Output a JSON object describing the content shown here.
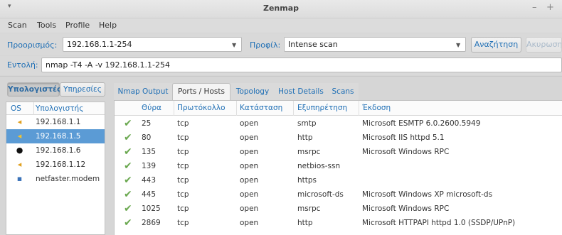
{
  "window": {
    "title": "Zenmap",
    "controls": [
      "–",
      "+"
    ]
  },
  "menu": [
    "Scan",
    "Tools",
    "Profile",
    "Help"
  ],
  "target": {
    "label": "Προορισμός:",
    "value": "192.168.1.1-254"
  },
  "profile": {
    "label": "Προφίλ:",
    "value": "Intense scan"
  },
  "buttons": {
    "scan": "Αναζήτηση",
    "cancel": "Ακυρωση"
  },
  "command": {
    "label": "Εντολή:",
    "value": "nmap -T4 -A -v 192.168.1.1-254"
  },
  "host_tabs": {
    "hosts": "Υπολογιστές",
    "services": "Υπηρεσίες"
  },
  "host_list": {
    "headers": {
      "os": "OS",
      "host": "Υπολογιστής"
    },
    "rows": [
      {
        "name": "192.168.1.1",
        "os_icon": "windows-flag-icon",
        "selected": false
      },
      {
        "name": "192.168.1.5",
        "os_icon": "windows-flag-icon",
        "selected": true
      },
      {
        "name": "192.168.1.6",
        "os_icon": "linux-penguin-icon",
        "selected": false
      },
      {
        "name": "192.168.1.12",
        "os_icon": "windows-flag-icon",
        "selected": false
      },
      {
        "name": "netfaster.modem",
        "os_icon": "unknown-os-icon",
        "selected": false
      }
    ]
  },
  "panel_tabs": [
    "Nmap Output",
    "Ports / Hosts",
    "Topology",
    "Host Details",
    "Scans"
  ],
  "active_panel_tab": "Ports / Hosts",
  "ports_table": {
    "headers": [
      "Θύρα",
      "Πρωτόκολλο",
      "Κατάσταση",
      "Εξυπηρέτηση",
      "Έκδοση"
    ],
    "rows": [
      {
        "port": "25",
        "protocol": "tcp",
        "state": "open",
        "service": "smtp",
        "version": "Microsoft ESMTP 6.0.2600.5949"
      },
      {
        "port": "80",
        "protocol": "tcp",
        "state": "open",
        "service": "http",
        "version": "Microsoft IIS httpd 5.1"
      },
      {
        "port": "135",
        "protocol": "tcp",
        "state": "open",
        "service": "msrpc",
        "version": "Microsoft Windows RPC"
      },
      {
        "port": "139",
        "protocol": "tcp",
        "state": "open",
        "service": "netbios-ssn",
        "version": ""
      },
      {
        "port": "443",
        "protocol": "tcp",
        "state": "open",
        "service": "https",
        "version": ""
      },
      {
        "port": "445",
        "protocol": "tcp",
        "state": "open",
        "service": "microsoft-ds",
        "version": "Microsoft Windows XP microsoft-ds"
      },
      {
        "port": "1025",
        "protocol": "tcp",
        "state": "open",
        "service": "msrpc",
        "version": "Microsoft Windows RPC"
      },
      {
        "port": "2869",
        "protocol": "tcp",
        "state": "open",
        "service": "http",
        "version": "Microsoft HTTPAPI httpd 1.0 (SSDP/UPnP)"
      }
    ]
  },
  "colors": {
    "accent": "#1f6fb5",
    "selection": "#5b9bd5",
    "check": "#6aa84f"
  }
}
